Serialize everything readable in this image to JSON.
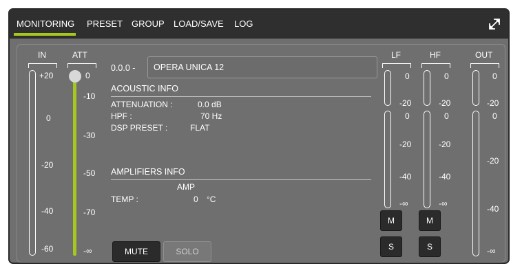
{
  "nav": {
    "tabs": [
      "MONITORING",
      "PRESET",
      "GROUP",
      "LOAD/SAVE",
      "LOG"
    ],
    "active": "MONITORING",
    "expand_icon": "expand-icon"
  },
  "colors": {
    "accent": "#a6c620",
    "panel": "#6f6f6f",
    "navbar": "#2f2f2f",
    "button": "#2b2b2b"
  },
  "in_meter": {
    "label": "IN",
    "scale": [
      "+20",
      "0",
      "-20",
      "-40",
      "-60"
    ]
  },
  "att_fader": {
    "label": "ATT",
    "scale": [
      "0",
      "-10",
      "-30",
      "-50",
      "-70",
      "-∞"
    ],
    "value_db": 0
  },
  "device": {
    "address": "0.0.0 -",
    "name": "OPERA UNICA 12"
  },
  "acoustic": {
    "title": "ACOUSTIC INFO",
    "rows": [
      {
        "label": "ATTENUATION :",
        "value": "0.0 dB"
      },
      {
        "label": "HPF :",
        "value": "70 Hz"
      },
      {
        "label": "DSP PRESET :",
        "value": "FLAT"
      }
    ]
  },
  "amplifiers": {
    "title": "AMPLIFIERS INFO",
    "column": "AMP",
    "temp_label": "TEMP :",
    "temp_value": "0",
    "temp_unit": "°C"
  },
  "buttons": {
    "mute": "MUTE",
    "solo": "SOLO"
  },
  "lf": {
    "label": "LF",
    "top_scale": [
      "0",
      "-20"
    ],
    "bottom_scale": [
      "0",
      "-20",
      "-40",
      "-∞"
    ],
    "mute": "M",
    "solo": "S"
  },
  "hf": {
    "label": "HF",
    "top_scale": [
      "0",
      "-20"
    ],
    "bottom_scale": [
      "0",
      "-20",
      "-40",
      "-∞"
    ],
    "mute": "M",
    "solo": "S"
  },
  "out": {
    "label": "OUT",
    "top_scale": [
      "0",
      "-20"
    ],
    "bottom_scale": [
      "0",
      "-20",
      "-40",
      "-∞"
    ]
  }
}
